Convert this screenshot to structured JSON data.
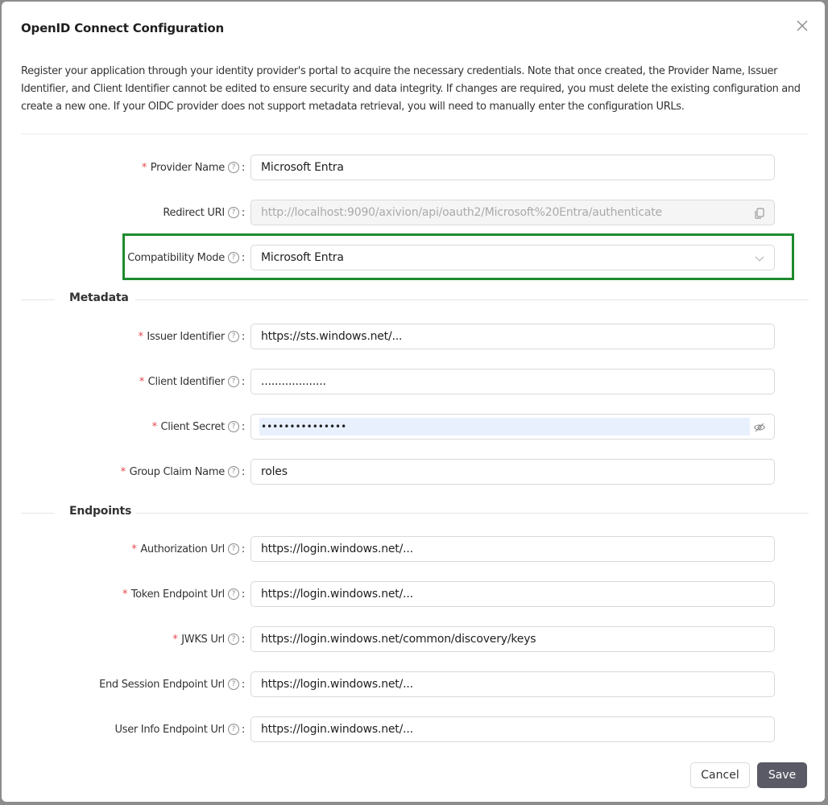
{
  "dialog": {
    "title": "OpenID Connect Configuration",
    "intro": "Register your application through your identity provider's portal to acquire the necessary credentials. Note that once created, the Provider Name, Issuer Identifier, and Client Identifier cannot be edited to ensure security and data integrity. If changes are required, you must delete the existing configuration and create a new one. If your OIDC provider does not support metadata retrieval, you will need to manually enter the configuration URLs.",
    "close_icon": "close-icon"
  },
  "general": {
    "provider_name": {
      "label": "Provider Name",
      "required": true,
      "value": "Microsoft Entra"
    },
    "redirect_uri": {
      "label": "Redirect URI",
      "required": false,
      "value": "http://localhost:9090/axivion/api/oauth2/Microsoft%20Entra/authenticate"
    },
    "compatibility_mode": {
      "label": "Compatibility Mode",
      "required": false,
      "value": "Microsoft Entra"
    }
  },
  "metadata": {
    "section_label": "Metadata",
    "issuer_identifier": {
      "label": "Issuer Identifier",
      "required": true,
      "value": "https://sts.windows.net/..."
    },
    "client_identifier": {
      "label": "Client Identifier",
      "required": true,
      "value": "..................."
    },
    "client_secret": {
      "label": "Client Secret",
      "required": true,
      "value": "•••••••••••••••"
    },
    "group_claim_name": {
      "label": "Group Claim Name",
      "required": true,
      "value": "roles"
    }
  },
  "endpoints": {
    "section_label": "Endpoints",
    "authorization_url": {
      "label": "Authorization Url",
      "required": true,
      "value": "https://login.windows.net/..."
    },
    "token_endpoint_url": {
      "label": "Token Endpoint Url",
      "required": true,
      "value": "https://login.windows.net/..."
    },
    "jwks_url": {
      "label": "JWKS Url",
      "required": true,
      "value": "https://login.windows.net/common/discovery/keys"
    },
    "end_session_endpoint_url": {
      "label": "End Session Endpoint Url",
      "required": false,
      "value": "https://login.windows.net/..."
    },
    "user_info_endpoint_url": {
      "label": "User Info Endpoint Url",
      "required": false,
      "value": "https://login.windows.net/..."
    }
  },
  "footer": {
    "cancel_label": "Cancel",
    "save_label": "Save"
  },
  "colors": {
    "highlight": "#1e8a2e",
    "required_marker": "#e5484d",
    "primary_button": "#5a5a66"
  }
}
